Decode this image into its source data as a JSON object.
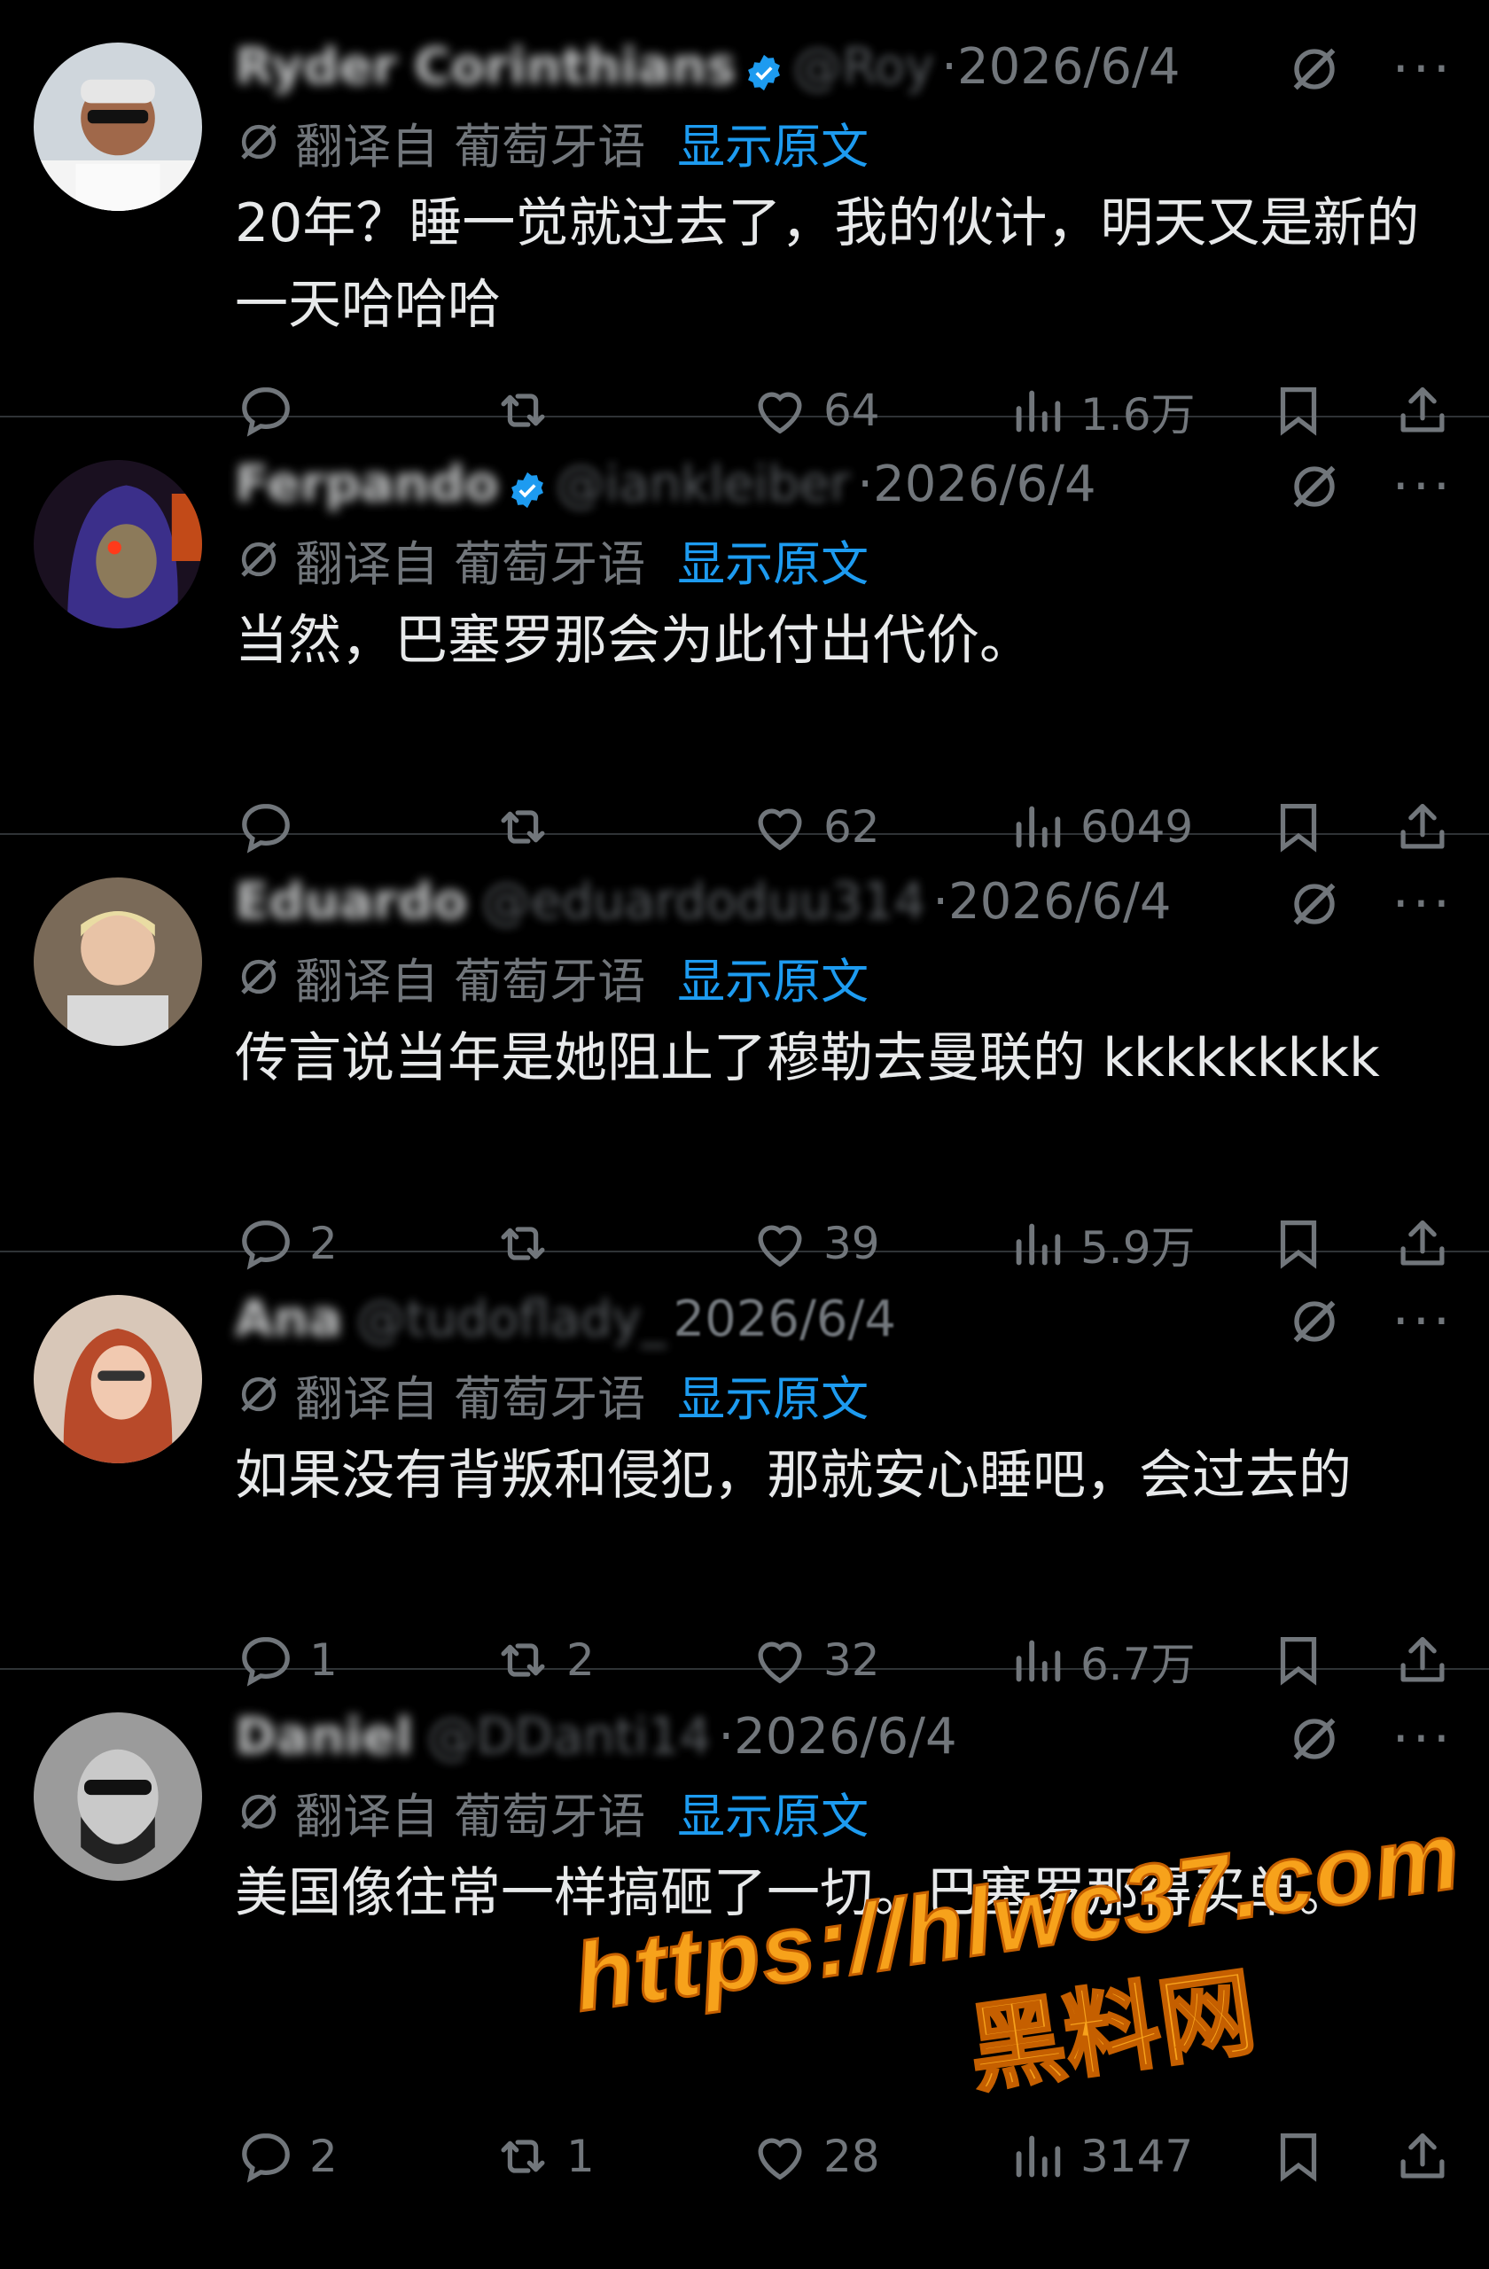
{
  "translate_label": "翻译自 葡萄牙语",
  "show_original": "显示原文",
  "tweets": [
    {
      "name": "Ryder Corinthians",
      "handle": "@Roy",
      "date": "·2026/6/4",
      "text": "20年？睡一觉就过去了，我的伙计，明天又是新的一天哈哈哈",
      "replies": "",
      "retweets": "",
      "likes": "64",
      "views": "1.6万",
      "verified": true
    },
    {
      "name": "Ferpando",
      "handle": "@iankleiber",
      "date": "·2026/6/4",
      "text": "当然，巴塞罗那会为此付出代价。",
      "replies": "",
      "retweets": "",
      "likes": "62",
      "views": "6049",
      "verified": true
    },
    {
      "name": "Eduardo",
      "handle": "@eduardoduu314",
      "date": "·2026/6/4",
      "text": "传言说当年是她阻止了穆勒去曼联的 kkkkkkkkk",
      "replies": "2",
      "retweets": "",
      "likes": "39",
      "views": "5.9万",
      "verified": false
    },
    {
      "name": "Ana",
      "handle": "@tudoflady_",
      "date": "2026/6/4",
      "text": "如果没有背叛和侵犯，那就安心睡吧，会过去的",
      "replies": "1",
      "retweets": "2",
      "likes": "32",
      "views": "6.7万",
      "verified": false
    },
    {
      "name": "Daniel",
      "handle": "@DDanti14",
      "date": "·2026/6/4",
      "text": "美国像往常一样搞砸了一切。巴塞罗那得买单。",
      "replies": "2",
      "retweets": "1",
      "likes": "28",
      "views": "3147",
      "verified": false
    }
  ],
  "watermark": {
    "url": "https://hlwc37.com",
    "site": "黑料网"
  },
  "colors": {
    "background": "#000000",
    "text": "#e7e9ea",
    "muted": "#71767b",
    "link": "#1d9bf0",
    "watermark": "#f7a21b"
  }
}
